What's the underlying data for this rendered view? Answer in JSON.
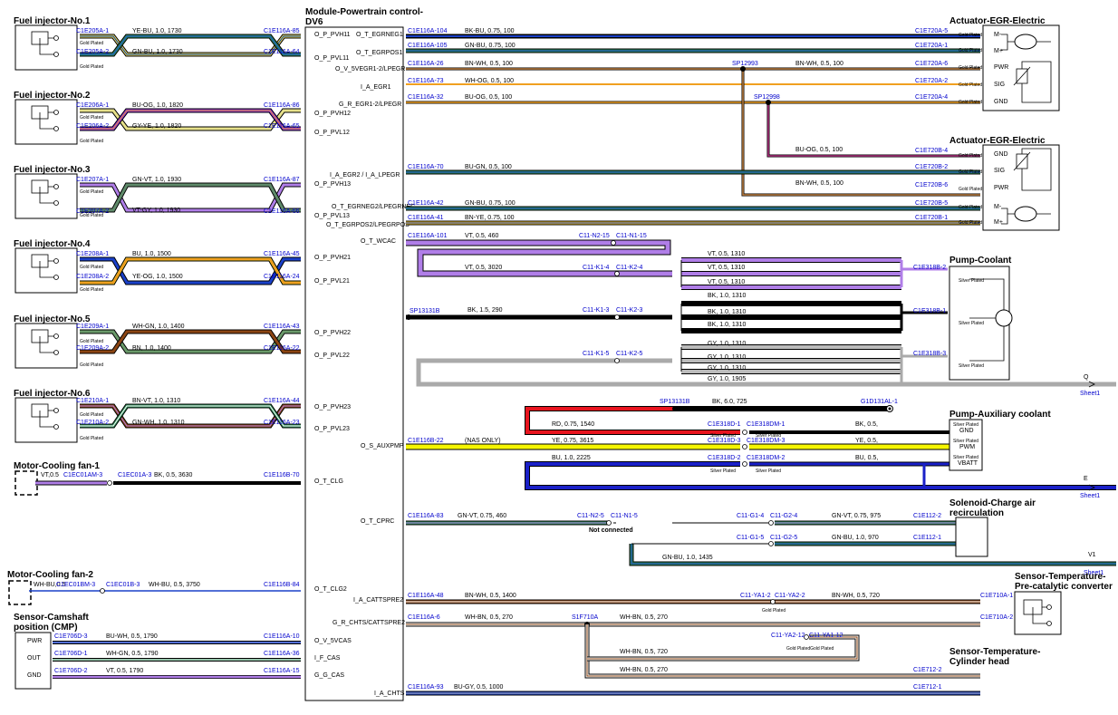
{
  "module": {
    "title_line1": "Module-Powertrain control-",
    "title_line2": "DV6"
  },
  "pins": {
    "p1": "O_P_PVH11",
    "p2": "O_T_EGRNEG1",
    "p3": "O_P_PVL11",
    "p4": "O_T_EGRPOS1",
    "p5": "O_V_5VEGR1-2/LPEGR",
    "p6": "I_A_EGR1",
    "p7": "G_R_EGR1-2/LPEGR",
    "p8": "O_P_PVH12",
    "p9": "O_P_PVL12",
    "p10": "I_A_EGR2 / I_A_LPEGR",
    "p11": "O_P_PVH13",
    "p12": "O_T_EGRNEG2/LPEGRNEG",
    "p13": "O_P_PVL13",
    "p14": "O_T_EGRPOS2/LPEGRPOS",
    "p15": "O_T_WCAC",
    "p16": "O_P_PVH21",
    "p17": "O_P_PVL21",
    "p18": "O_P_PVH22",
    "p19": "O_P_PVL22",
    "p20": "O_P_PVH23",
    "p21": "O_P_PVL23",
    "p22": "O_S_AUXPMP",
    "p23": "O_T_CLG",
    "p24": "O_T_CPRC",
    "p25": "O_T_CLG2",
    "p26": "I_A_CATTSPRE2",
    "p27": "G_R_CHTS/CATTSPRE2",
    "p28": "O_V_5VCAS",
    "p29": "I_F_CAS",
    "p30": "G_G_CAS",
    "p31": "I_A_CHTS"
  },
  "components": {
    "inj1": "Fuel injector-No.1",
    "inj2": "Fuel injector-No.2",
    "inj3": "Fuel injector-No.3",
    "inj4": "Fuel injector-No.4",
    "inj5": "Fuel injector-No.5",
    "inj6": "Fuel injector-No.6",
    "fan1": "Motor-Cooling fan-1",
    "fan2": "Motor-Cooling fan-2",
    "cmp1": "Sensor-Camshaft",
    "cmp2": "position (CMP)",
    "egr1": "Actuator-EGR-Electric",
    "egr2": "Actuator-EGR-Electric",
    "pumpc": "Pump-Coolant",
    "pumpa": "Pump-Auxiliary coolant",
    "sol1": "Solenoid-Charge air",
    "sol2": "recirculation",
    "tpre1": "Sensor-Temperature-",
    "tpre2": "Pre-catalytic converter",
    "tcyl1": "Sensor-Temperature-",
    "tcyl2": "Cylinder head"
  },
  "plating": {
    "gold": "Gold Plated",
    "silver": "Silver Plated",
    "goldgold": "Gold PlatedGold Plated"
  },
  "egr_pins": {
    "m_minus": "M-",
    "m_plus": "M+",
    "pwr": "PWR",
    "sig": "SIG",
    "gnd": "GND"
  },
  "aux_pins": {
    "gnd": "GND",
    "pwm": "PWM",
    "vbatt": "VBATT"
  },
  "cmp_pins": {
    "pwr": "PWR",
    "out": "OUT",
    "gnd": "GND"
  },
  "notes": {
    "nas": "(NAS ONLY)",
    "not_connected": "Not connected"
  },
  "refs": {
    "q": "Q",
    "e": "E",
    "v1": "V1",
    "sheet": "Sheet1"
  },
  "connectors": {
    "c1": "C1E205A-1",
    "c2": "C1E205A-2",
    "c3": "C1E116A-85",
    "c4": "C1E116A-64",
    "c5": "C1E206A-1",
    "c6": "C1E206A-2",
    "c7": "C1E116A-86",
    "c8": "C1E116A-65",
    "c9": "C1E207A-1",
    "c10": "C1E207A-2",
    "c11": "C1E116A-87",
    "c12": "C1E116A-66",
    "c13": "C1E208A-1",
    "c14": "C1E208A-2",
    "c15": "C1E116A-45",
    "c16": "C1E116A-24",
    "c17": "C1E209A-1",
    "c18": "C1E209A-2",
    "c19": "C1E116A-43",
    "c20": "C1E116A-22",
    "c21": "C1E210A-1",
    "c22": "C1E210A-2",
    "c23": "C1E116A-44",
    "c24": "C1E116A-23",
    "c25": "C1EC01AM-3",
    "c26": "C1EC01A-3",
    "c27": "C1E116B-70",
    "c28": "C1EC01BM-3",
    "c29": "C1EC01B-3",
    "c30": "C1E116B-84",
    "c31": "C1E706D-3",
    "c32": "C1E706D-1",
    "c33": "C1E706D-2",
    "c34": "C1E116A-10",
    "c35": "C1E116A-36",
    "c36": "C1E116A-15",
    "c37": "C1E116A-104",
    "c38": "C1E116A-105",
    "c39": "C1E116A-26",
    "c40": "C1E116A-73",
    "c41": "C1E116A-32",
    "c42": "C1E720A-5",
    "c43": "C1E720A-1",
    "c44": "C1E720A-6",
    "c45": "C1E720A-2",
    "c46": "C1E720A-4",
    "c47": "SP12993",
    "c48": "SP12998",
    "c49": "C1E116A-70",
    "c50": "C1E116A-42",
    "c51": "C1E116A-41",
    "c52": "C1E720B-4",
    "c53": "C1E720B-2",
    "c54": "C1E720B-6",
    "c55": "C1E720B-5",
    "c56": "C1E720B-1",
    "c57": "C1E116A-101",
    "c58": "C11-N2-15",
    "c59": "C11-N1-15",
    "c60": "C11-K1-4",
    "c61": "C11-K2-4",
    "c62": "SP13131B",
    "c63": "C11-K1-3",
    "c64": "C11-K2-3",
    "c65": "C11-K1-5",
    "c66": "C11-K2-5",
    "c67": "C1E318B-2",
    "c68": "C1E318B-1",
    "c69": "C1E318B-3",
    "c70": "SP13131B",
    "c71": "G1D131AL-1",
    "c72": "C1E116B-22",
    "c73": "C1E318D-1",
    "c74": "C1E318DM-1",
    "c75": "C1E318D-3",
    "c76": "C1E318DM-3",
    "c77": "C1E318D-2",
    "c78": "C1E318DM-2",
    "c79": "C1E116A-83",
    "c80": "C11-N2-5",
    "c81": "C11-N1-5",
    "c82": "C11-G1-4",
    "c83": "C11-G2-4",
    "c84": "C1E112-2",
    "c85": "C11-G1-5",
    "c86": "C11-G2-5",
    "c87": "C1E112-1",
    "c88": "C1E116A-48",
    "c89": "C11-YA1-2",
    "c90": "C11-YA2-2",
    "c91": "C1E710A-1",
    "c92": "C1E116A-6",
    "c93": "S1F710A",
    "c94": "C1E710A-2",
    "c95": "C11-YA2-12",
    "c96": "C11-YA1-12",
    "c97": "C1E712-2",
    "c98": "C1E116A-93",
    "c99": "C1E712-1"
  },
  "wires": {
    "w1": "YE-BU, 1.0, 1730",
    "w2": "GN-BU, 1.0, 1730",
    "w3": "BU-OG, 1.0, 1820",
    "w4": "GY-YE, 1.0, 1820",
    "w5": "GN-VT, 1.0, 1930",
    "w6": "VT-GY, 1.0, 1930",
    "w7": "BU, 1.0, 1500",
    "w8": "YE-OG, 1.0, 1500",
    "w9": "WH-GN, 1.0, 1400",
    "w10": "BN, 1.0, 1400",
    "w11": "BN-VT, 1.0, 1310",
    "w12": "GN-WH, 1.0, 1310",
    "w13": "VT,0.5",
    "w14": "BK, 0.5, 3630",
    "w15": "WH-BU,0.5",
    "w16": "WH-BU, 0.5, 3750",
    "w17": "BU-WH, 0.5, 1790",
    "w18": "WH-GN, 0.5, 1790",
    "w19": "VT, 0.5, 1790",
    "w20": "BK-BU, 0.75, 100",
    "w21": "GN-BU, 0.75, 100",
    "w22": "BN-WH, 0.5, 100",
    "w23": "BN-WH, 0.5, 100",
    "w24": "WH-OG, 0.5, 100",
    "w25": "BU-OG, 0.5, 100",
    "w26": "BU-OG, 0.5, 100",
    "w27": "BU-GN, 0.5, 100",
    "w28": "BN-WH, 0.5, 100",
    "w29": "GN-BU, 0.75, 100",
    "w30": "BN-YE, 0.75, 100",
    "w31": "VT, 0.5, 460",
    "w32": "VT, 0.5, 3020",
    "w33": "VT, 0.5, 1310",
    "w34": "VT, 0.5, 1310",
    "w35": "VT, 0.5, 1310",
    "w36": "BK, 1.5, 290",
    "w37": "BK, 1.0, 1310",
    "w38": "BK, 1.0, 1310",
    "w39": "BK, 1.0, 1310",
    "w40": "GY, 1.0, 1310",
    "w41": "GY, 1.0, 1310",
    "w42": "GY, 1.0, 1310",
    "w43": "GY, 1.0, 1905",
    "w44": "BK, 6.0, 725",
    "w45": "RD, 0.75, 1540",
    "w46": "BK, 0.5,",
    "w47": "YE, 0.75, 3615",
    "w48": "YE, 0.5,",
    "w49": "BU, 1.0, 2225",
    "w50": "BU, 0.5,",
    "w51": "GN-VT, 0.75, 460",
    "w52": "GN-VT, 0.75, 975",
    "w53": "GN-BU, 1.0, 970",
    "w54": "GN-BU, 1.0, 1435",
    "w55": "BN-WH, 0.5, 1400",
    "w56": "BN-WH, 0.5, 720",
    "w57": "WH-BN, 0.5, 270",
    "w58": "WH-BN, 0.5, 270",
    "w59": "WH-BN, 0.5, 720",
    "w60": "WH-BN, 0.5, 270",
    "w61": "BU-GY, 0.5, 1000"
  }
}
